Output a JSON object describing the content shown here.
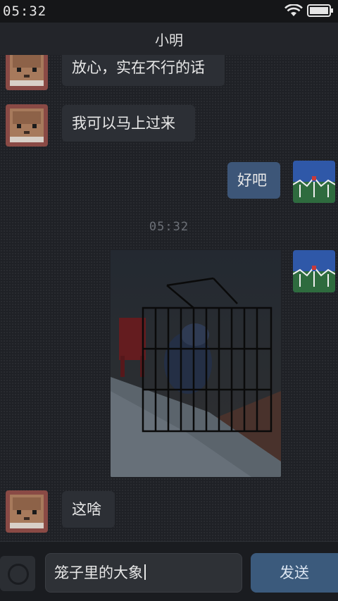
{
  "status_bar": {
    "time": "05:32",
    "wifi_icon": "wifi-icon",
    "battery_icon": "battery-icon"
  },
  "header": {
    "title": "小明"
  },
  "messages": [
    {
      "side": "left",
      "text": "放心，实在不行的话",
      "avatar": "contact-avatar"
    },
    {
      "side": "left",
      "text": "我可以马上过来",
      "avatar": "contact-avatar"
    },
    {
      "side": "right",
      "text": "好吧",
      "avatar": "my-avatar"
    },
    {
      "type": "timestamp",
      "text": "05:32"
    },
    {
      "side": "right",
      "type": "image",
      "description": "cage-photo",
      "avatar": "my-avatar"
    },
    {
      "side": "left",
      "text": "这啥",
      "avatar": "contact-avatar"
    }
  ],
  "input_bar": {
    "camera_icon": "camera-icon",
    "input_value": "笼子里的大象",
    "send_label": "发送"
  },
  "colors": {
    "bubble_left": "#2c2f35",
    "bubble_right": "#3d5678",
    "send_button": "#3b5a7c",
    "background": "#1f2126"
  }
}
